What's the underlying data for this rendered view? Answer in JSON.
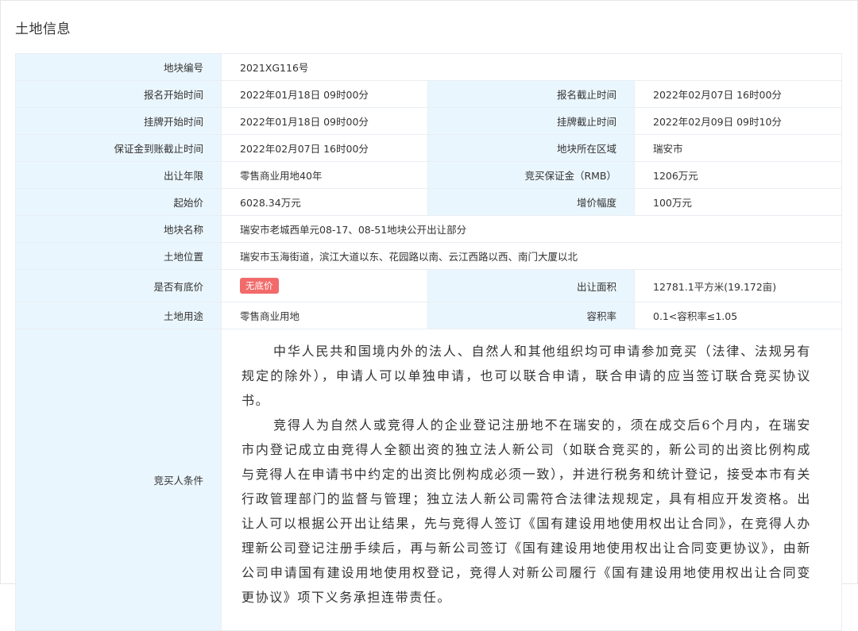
{
  "page": {
    "title": "土地信息"
  },
  "rows": {
    "plot_no": {
      "label": "地块编号",
      "value": "2021XG116号"
    },
    "signup_start": {
      "label": "报名开始时间",
      "value": "2022年01月18日 09时00分"
    },
    "signup_end": {
      "label": "报名截止时间",
      "value": "2022年02月07日 16时00分"
    },
    "listing_start": {
      "label": "挂牌开始时间",
      "value": "2022年01月18日 09时00分"
    },
    "listing_end": {
      "label": "挂牌截止时间",
      "value": "2022年02月09日 09时10分"
    },
    "deposit_deadline": {
      "label": "保证金到账截止时间",
      "value": "2022年02月07日 16时00分"
    },
    "region": {
      "label": "地块所在区域",
      "value": "瑞安市"
    },
    "term": {
      "label": "出让年限",
      "value": "零售商业用地40年"
    },
    "deposit": {
      "label": "竞买保证金（RMB）",
      "value": "1206万元"
    },
    "start_price": {
      "label": "起始价",
      "value": "6028.34万元"
    },
    "increment": {
      "label": "增价幅度",
      "value": "100万元"
    },
    "plot_name": {
      "label": "地块名称",
      "value": "瑞安市老城西单元08-17、08-51地块公开出让部分"
    },
    "location": {
      "label": "土地位置",
      "value": "瑞安市玉海街道，滨江大道以东、花园路以南、云江西路以西、南门大厦以北"
    },
    "reserve_price": {
      "label": "是否有底价",
      "badge": "无底价"
    },
    "area": {
      "label": "出让面积",
      "value": "12781.1平方米(19.172亩)"
    },
    "usage": {
      "label": "土地用途",
      "value": "零售商业用地"
    },
    "far": {
      "label": "容积率",
      "value": "0.1<容积率≤1.05"
    },
    "bidder_conditions": {
      "label": "竞买人条件",
      "paragraphs": [
        "中华人民共和国境内外的法人、自然人和其他组织均可申请参加竞买（法律、法规另有规定的除外），申请人可以单独申请，也可以联合申请，联合申请的应当签订联合竞买协议书。",
        "竞得人为自然人或竞得人的企业登记注册地不在瑞安的，须在成交后6个月内，在瑞安市内登记成立由竞得人全额出资的独立法人新公司（如联合竞买的，新公司的出资比例构成与竞得人在申请书中约定的出资比例构成必须一致），并进行税务和统计登记，接受本市有关行政管理部门的监督与管理；独立法人新公司需符合法律法规规定，具有相应开发资格。出让人可以根据公开出让结果，先与竞得人签订《国有建设用地使用权出让合同》，在竞得人办理新公司登记注册手续后，再与新公司签订《国有建设用地使用权出让合同变更协议》，由新公司申请国有建设用地使用权登记，竞得人对新公司履行《国有建设用地使用权出让合同变更协议》项下义务承担连带责任。"
      ]
    }
  }
}
